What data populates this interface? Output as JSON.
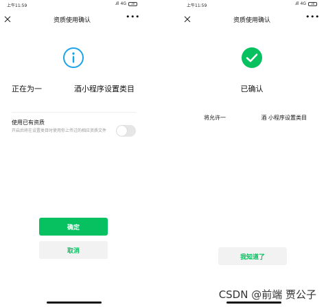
{
  "left_screen": {
    "status_bar": {
      "time": "上午11:59",
      "signal": ".ıll",
      "network": "4G",
      "battery": "38"
    },
    "nav": {
      "title": "资质使用确认"
    },
    "info_line": {
      "left": "正在为一",
      "right": "酒小程序设置类目"
    },
    "resource": {
      "title": "使用已有资质",
      "description": "开启后将在设置类目时使用你上传过的相应资质文件"
    },
    "buttons": {
      "confirm": "确定",
      "cancel": "取消"
    }
  },
  "right_screen": {
    "status_bar": {
      "time": "上午11:59",
      "signal": ".ıll",
      "network": "4G",
      "battery": "38"
    },
    "nav": {
      "title": "资质使用确认"
    },
    "confirmed_title": "已确认",
    "allow_line": {
      "left": "将允许一",
      "right": "酒 小程序设置类目"
    },
    "buttons": {
      "know": "我知道了"
    }
  },
  "watermark": "CSDN @前端 贾公子",
  "colors": {
    "accent": "#07c160",
    "info_blue": "#1aa3e8"
  }
}
